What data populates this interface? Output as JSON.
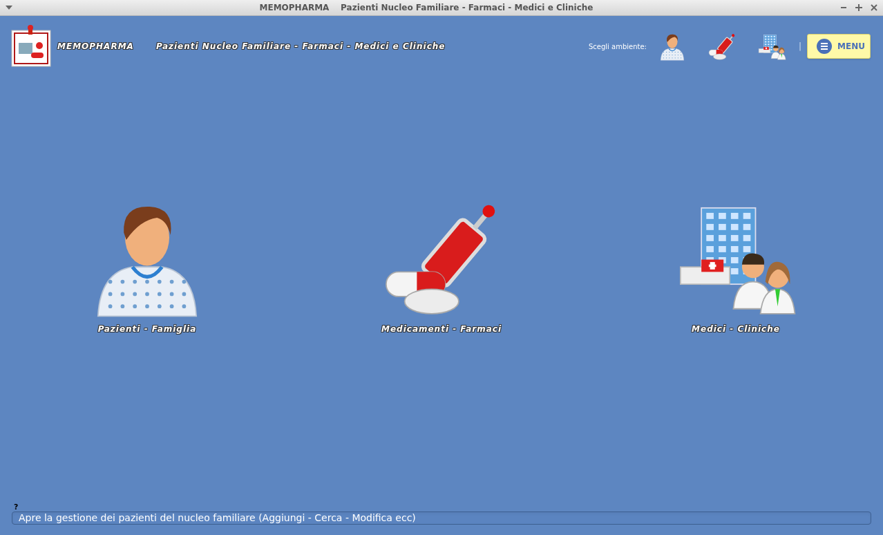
{
  "window": {
    "title": "MEMOPHARMA    Pazienti Nucleo Familiare - Farmaci - Medici e Cliniche"
  },
  "header": {
    "app_name": "MEMOPHARMA",
    "subtitle": "Pazienti Nucleo Familiare - Farmaci - Medici e Cliniche",
    "environment_label": "Scegli ambiente:",
    "environments": [
      {
        "kind": "patient"
      },
      {
        "kind": "medicine"
      },
      {
        "kind": "clinic"
      }
    ],
    "separator": "|",
    "menu_button": "MENU"
  },
  "tiles": [
    {
      "kind": "patient",
      "label": "Pazienti - Famiglia"
    },
    {
      "kind": "medicine",
      "label": "Medicamenti - Farmaci"
    },
    {
      "kind": "clinic",
      "label": "Medici - Cliniche"
    }
  ],
  "help": {
    "mark": "?",
    "status_text": "Apre la gestione dei pazienti del nucleo familiare (Aggiungi - Cerca - Modifica ecc)"
  }
}
